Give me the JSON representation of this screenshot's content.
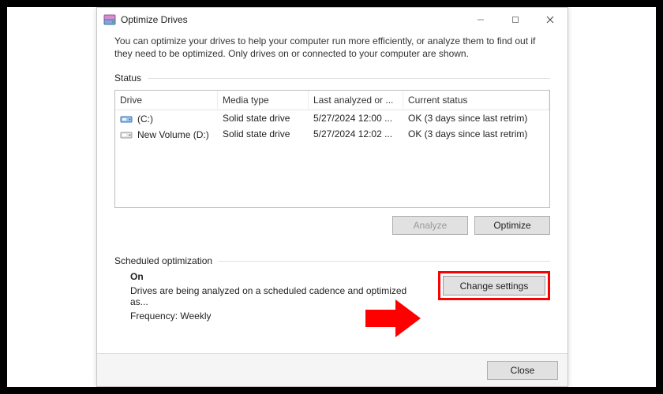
{
  "window": {
    "title": "Optimize Drives"
  },
  "description": "You can optimize your drives to help your computer run more efficiently, or analyze them to find out if they need to be optimized. Only drives on or connected to your computer are shown.",
  "status_label": "Status",
  "columns": {
    "drive": "Drive",
    "media": "Media type",
    "last": "Last analyzed or ...",
    "status": "Current status"
  },
  "drives": [
    {
      "name": "(C:)",
      "media": "Solid state drive",
      "last": "5/27/2024 12:00 ...",
      "status": "OK (3 days since last retrim)"
    },
    {
      "name": "New Volume (D:)",
      "media": "Solid state drive",
      "last": "5/27/2024 12:02 ...",
      "status": "OK (3 days since last retrim)"
    }
  ],
  "buttons": {
    "analyze": "Analyze",
    "optimize": "Optimize",
    "change_settings": "Change settings",
    "close": "Close"
  },
  "scheduled": {
    "heading": "Scheduled optimization",
    "state": "On",
    "desc": "Drives are being analyzed on a scheduled cadence and optimized as...",
    "freq_label": "Frequency:",
    "freq_value": "Weekly"
  }
}
